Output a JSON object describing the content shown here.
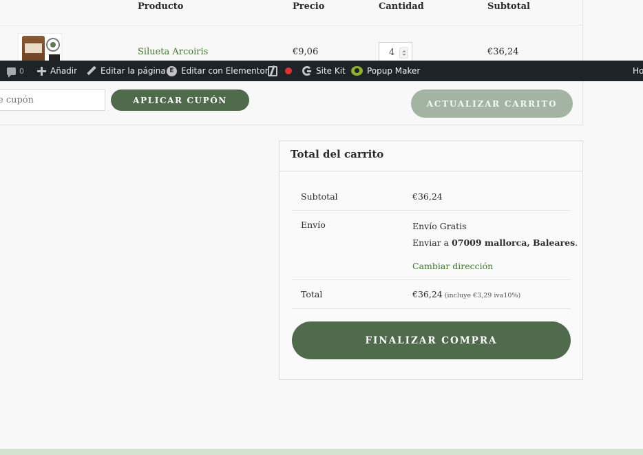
{
  "cart": {
    "headers": {
      "product": "Producto",
      "price": "Precio",
      "quantity": "Cantidad",
      "subtotal": "Subtotal"
    },
    "item": {
      "name": "Silueta Arcoiris",
      "price": "€9,06",
      "quantity": "4",
      "subtotal": "€36,24"
    }
  },
  "admin_bar": {
    "comments_count": "0",
    "add_label": "Añadir",
    "edit_page_label": "Editar la página",
    "elementor_label": "Editar con Elementor",
    "sitekit_label": "Site Kit",
    "popup_label": "Popup Maker",
    "howdy_label": "Ho",
    "icons": [
      "comment-icon",
      "plus-icon",
      "pencil-icon",
      "elementor-icon",
      "yoast-icon",
      "seo-status-icon",
      "google-icon",
      "popup-maker-icon"
    ],
    "status_dot_color": "#dc3232"
  },
  "actions": {
    "coupon_placeholder": "e cupón",
    "apply_coupon": "APLICAR CUPÓN",
    "update_cart": "ACTUALIZAR CARRITO"
  },
  "totals": {
    "title": "Total del carrito",
    "subtotal_label": "Subtotal",
    "subtotal_value": "€36,24",
    "shipping_label": "Envío",
    "shipping_method": "Envío Gratis",
    "shipping_prefix": "Enviar a ",
    "shipping_destination": "07009 mallorca, Baleares",
    "shipping_suffix": ".",
    "change_address": "Cambiar dirección",
    "total_label": "Total",
    "total_value": "€36,24",
    "total_tax_note": "(incluye €3,29 iva10%)",
    "checkout": "FINALIZAR COMPRA"
  },
  "colors": {
    "primary_green": "#4f6b4c",
    "link_green": "#3c7a2a",
    "disabled_green": "#a3b5a2",
    "admin_bar": "#1d2327"
  }
}
